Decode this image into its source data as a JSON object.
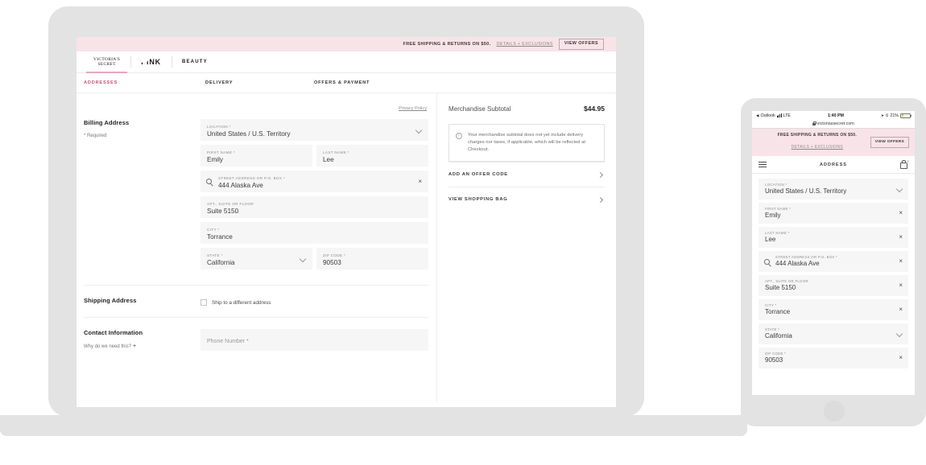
{
  "desktop": {
    "promo": {
      "text": "FREE SHIPPING & RETURNS ON $50.",
      "link": "DETAILS + EXCLUSIONS",
      "button": "VIEW OFFERS"
    },
    "brand_tabs": [
      {
        "label": "VICTORIA'S",
        "label2": "SECRET",
        "active": true
      },
      {
        "label": "PINK",
        "active": false
      },
      {
        "label": "BEAUTY",
        "active": false
      }
    ],
    "steps": [
      {
        "label": "ADDRESSES",
        "active": true
      },
      {
        "label": "DELIVERY",
        "active": false
      },
      {
        "label": "OFFERS & PAYMENT",
        "active": false
      }
    ],
    "billing": {
      "title": "Billing Address",
      "required_note": "* Required",
      "privacy_link": "Privacy Policy",
      "location": {
        "label": "LOCATION *",
        "value": "United States / U.S. Territory"
      },
      "first_name": {
        "label": "FIRST NAME *",
        "value": "Emily"
      },
      "last_name": {
        "label": "LAST NAME *",
        "value": "Lee"
      },
      "street": {
        "label": "STREET ADDRESS OR P.O. BOX *",
        "value": "444 Alaska Ave"
      },
      "apt": {
        "label": "APT., SUITE OR FLOOR",
        "value": "Suite 5150"
      },
      "city": {
        "label": "CITY *",
        "value": "Torrance"
      },
      "state": {
        "label": "STATE *",
        "value": "California"
      },
      "zip": {
        "label": "ZIP CODE *",
        "value": "90503"
      }
    },
    "shipping": {
      "title": "Shipping Address",
      "checkbox_label": "Ship to a different address",
      "checked": false
    },
    "contact": {
      "title": "Contact Information",
      "why_link": "Why do we need this?",
      "phone_placeholder": "Phone Number *"
    },
    "summary": {
      "subtotal_label": "Merchandise Subtotal",
      "subtotal_value": "$44.95",
      "info_text": "Your merchandise subtotal does not yet include delivery charges nor taxes, if applicable, which will be reflected at Checkout.",
      "links": [
        {
          "label": "ADD AN OFFER CODE"
        },
        {
          "label": "VIEW SHOPPING BAG"
        }
      ]
    }
  },
  "mobile": {
    "status": {
      "carrier_back": "Outlook",
      "network": "LTE",
      "time": "1:40 PM",
      "battery_pct": "21%"
    },
    "url": "victoriassecret.com",
    "promo": {
      "line1": "FREE SHIPPING & RETURNS ON $50.",
      "line2": "DETAILS + EXCLUSIONS",
      "button": "VIEW OFFERS"
    },
    "nav": {
      "title": "ADDRESS"
    },
    "fields": [
      {
        "label": "LOCATION *",
        "value": "United States / U.S. Territory",
        "control": "chevron"
      },
      {
        "label": "FIRST NAME *",
        "value": "Emily",
        "control": "clear"
      },
      {
        "label": "LAST NAME *",
        "value": "Lee",
        "control": "clear"
      },
      {
        "label": "STREET ADDRESS OR P.O. BOX *",
        "value": "444 Alaska Ave",
        "control": "clear",
        "search": true
      },
      {
        "label": "APT., SUITE OR FLOOR",
        "value": "Suite 5150",
        "control": "clear"
      },
      {
        "label": "CITY *",
        "value": "Torrance",
        "control": "clear"
      },
      {
        "label": "STATE *",
        "value": "California",
        "control": "chevron"
      },
      {
        "label": "ZIP CODE *",
        "value": "90503",
        "control": "clear"
      }
    ]
  },
  "colors": {
    "accent_pink": "#c8527a",
    "banner_pink": "#f8e3e8",
    "tab_underline": "#e7a7bb",
    "device_gray": "#e3e3e3",
    "field_bg": "#f6f6f6"
  }
}
